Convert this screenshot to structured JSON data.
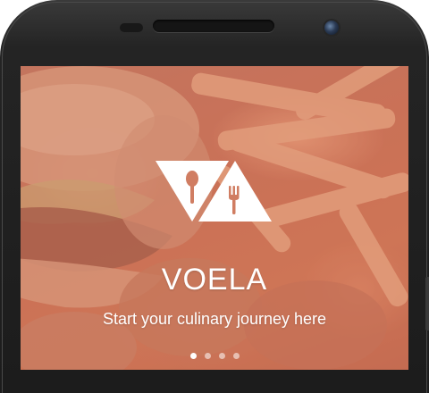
{
  "app": {
    "title": "VOELA",
    "tagline": "Start your culinary journey here"
  },
  "logo": {
    "left_icon": "spoon-icon",
    "right_icon": "fork-icon",
    "color": "#ffffff"
  },
  "background": {
    "overlay_color": "#cd6955"
  },
  "pager": {
    "total": 4,
    "active_index": 0
  }
}
